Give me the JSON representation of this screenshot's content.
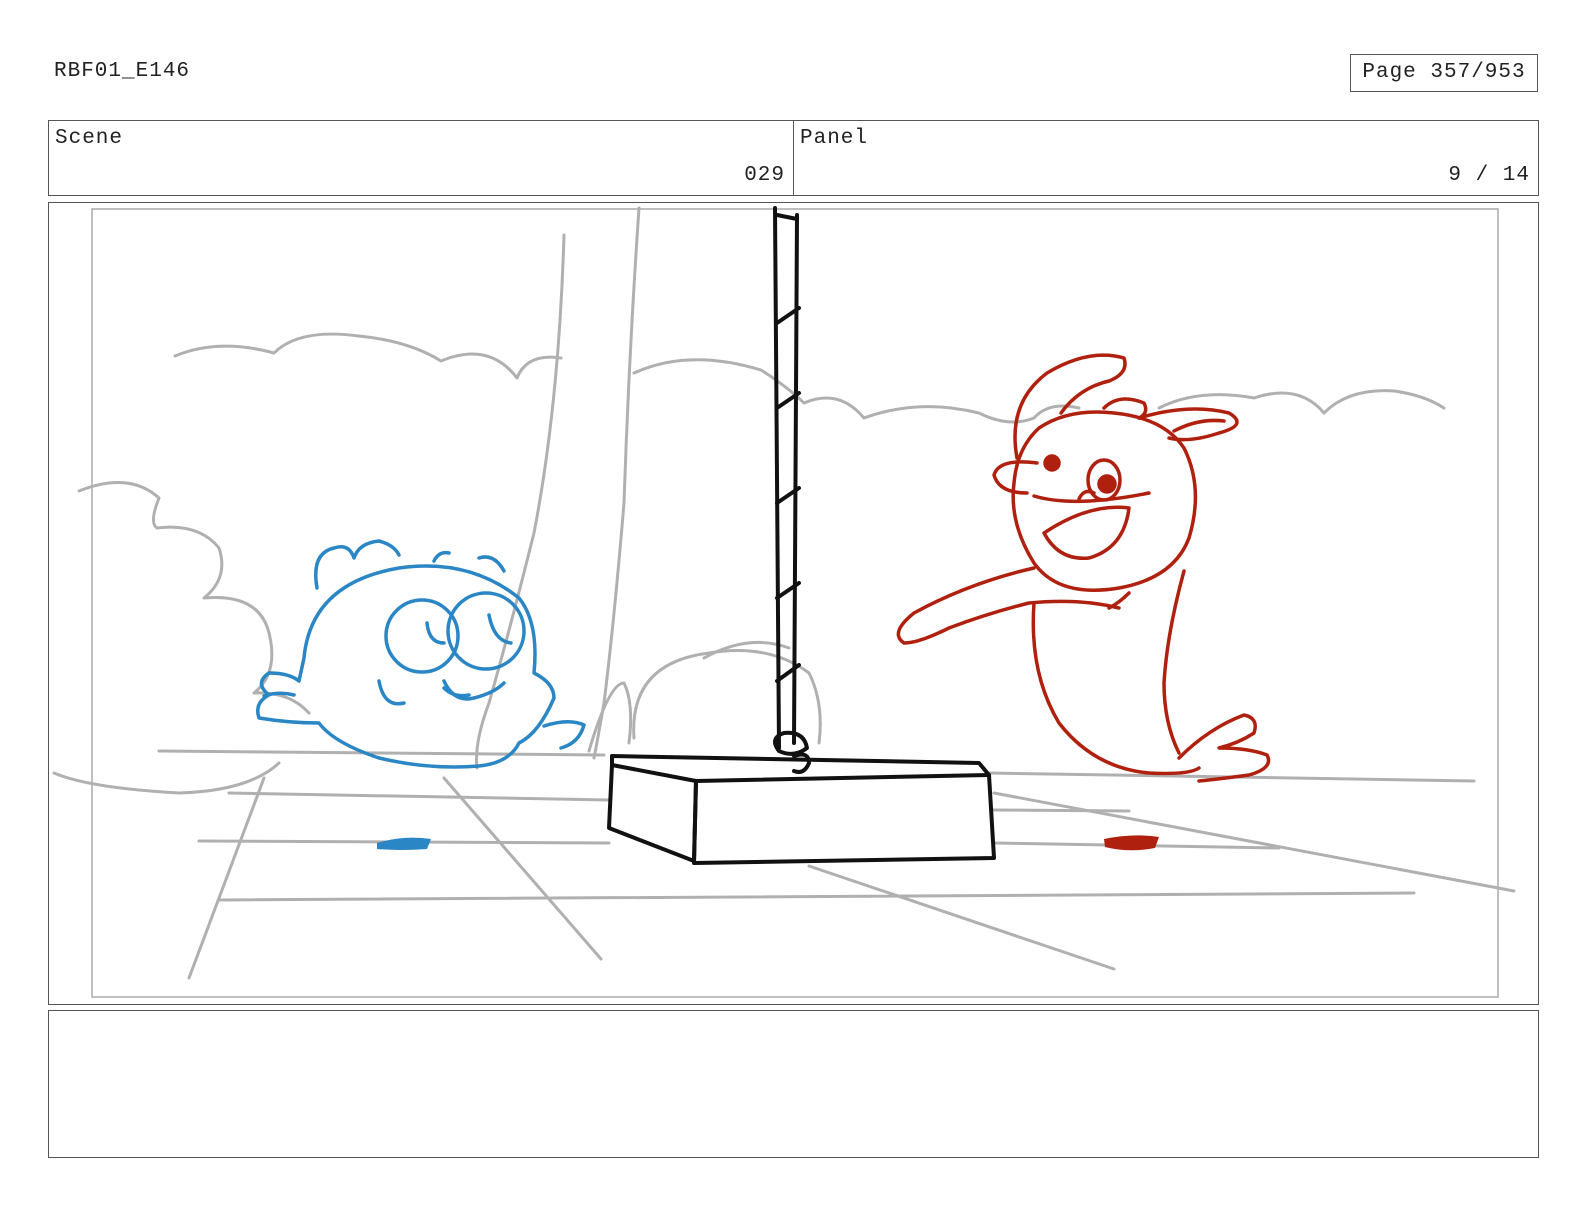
{
  "header": {
    "doc_id": "RBF01_E146",
    "page_label": "Page 357/953"
  },
  "info": {
    "scene_label": "Scene",
    "scene_value": "029",
    "panel_label": "Panel",
    "panel_value": "9 / 14"
  },
  "notes": {
    "text": ""
  },
  "colors": {
    "background_sketch": "#b0b0b0",
    "blue_character": "#2a86c4",
    "red_character": "#b0200f",
    "ink": "#111111",
    "border": "#555555"
  }
}
